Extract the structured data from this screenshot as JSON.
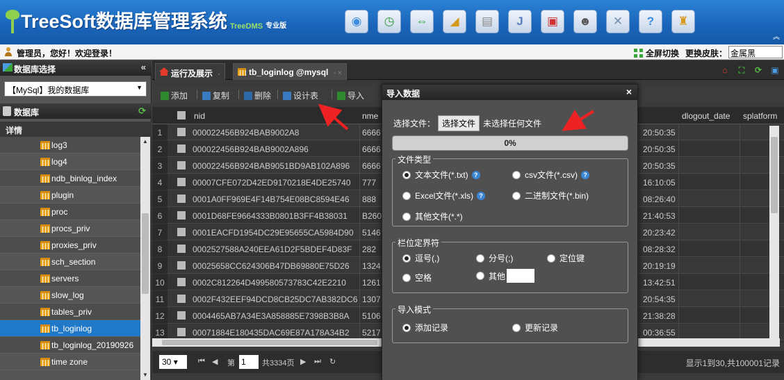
{
  "banner": {
    "title": "TreeSoft数据库管理系统",
    "subtitle": "TreeDMS",
    "edition": "专业版",
    "tools": [
      {
        "icon": "refresh-globe-icon",
        "color": "#3a8be0"
      },
      {
        "icon": "clock-icon",
        "color": "#2a9d3a"
      },
      {
        "icon": "sync-arrows-icon",
        "color": "#2a9d3a"
      },
      {
        "icon": "chart-icon",
        "color": "#d69a1a"
      },
      {
        "icon": "document-icon",
        "color": "#888888"
      },
      {
        "icon": "j-icon",
        "color": "#5b7fc0"
      },
      {
        "icon": "log-icon",
        "color": "#d03030"
      },
      {
        "icon": "user-icon",
        "color": "#555555"
      },
      {
        "icon": "tools-icon",
        "color": "#7090b0"
      },
      {
        "icon": "help-icon",
        "color": "#3a8be0"
      },
      {
        "icon": "lock-icon",
        "color": "#d69a1a"
      }
    ]
  },
  "welcome": {
    "text": "管理员，您好！欢迎登录！",
    "fullscreen": "全屏切换",
    "skin_label": "更换皮肤：",
    "skin_value": "金属黑"
  },
  "sidebar": {
    "header": "数据库选择",
    "db_select": "【MySql】我的数据库",
    "db_header": "数据库",
    "detail": "详情",
    "items": [
      {
        "label": "log3"
      },
      {
        "label": "log4"
      },
      {
        "label": "ndb_binlog_index"
      },
      {
        "label": "plugin"
      },
      {
        "label": "proc"
      },
      {
        "label": "procs_priv"
      },
      {
        "label": "proxies_priv"
      },
      {
        "label": "sch_section"
      },
      {
        "label": "servers"
      },
      {
        "label": "slow_log"
      },
      {
        "label": "tables_priv"
      },
      {
        "label": "tb_loginlog"
      },
      {
        "label": "tb_loginlog_20190926"
      },
      {
        "label": "time zone"
      }
    ],
    "active_index": 11
  },
  "tabs": [
    {
      "label": "运行及展示"
    },
    {
      "label": "tb_loginlog @mysql"
    }
  ],
  "toolbar": {
    "add": "添加",
    "copy": "复制",
    "delete": "删除",
    "design": "设计表",
    "import": "导入"
  },
  "grid": {
    "columns": {
      "nid": "nid",
      "nme": "nme",
      "dlogout": "dlogout_date",
      "splatform": "splatform"
    },
    "rows": [
      {
        "n": "1",
        "nid": "000022456B924BAB9002A8",
        "nme": "6666",
        "dt": "20:50:35"
      },
      {
        "n": "2",
        "nid": "000022456B924BAB9002A896",
        "nme": "6666",
        "dt": "20:50:35"
      },
      {
        "n": "3",
        "nid": "000022456B924BAB9051BD9AB102A896",
        "nme": "6666",
        "dt": "20:50:35"
      },
      {
        "n": "4",
        "nid": "00007CFE072D42ED9170218E4DE25740",
        "nme": "777",
        "dt": "16:10:05"
      },
      {
        "n": "5",
        "nid": "0001A0FF969E4F14B754E08BC8594E46",
        "nme": "888",
        "dt": "08:26:40"
      },
      {
        "n": "6",
        "nid": "0001D68FE9664333B0801B3FF4B38031",
        "nme": "B260",
        "dt": "21:40:53"
      },
      {
        "n": "7",
        "nid": "0001EACFD1954DC29E95655CA5984D90",
        "nme": "5146",
        "dt": "20:23:42"
      },
      {
        "n": "8",
        "nid": "0002527588A240EEA61D2F5BDEF4D83F",
        "nme": "282",
        "dt": "08:28:32"
      },
      {
        "n": "9",
        "nid": "00025658CC624306B47DB69880E75D26",
        "nme": "1324",
        "dt": "20:19:19"
      },
      {
        "n": "10",
        "nid": "0002C812264D499580573783C42E2210",
        "nme": "1261",
        "dt": "13:42:51"
      },
      {
        "n": "11",
        "nid": "0002F432EEF94DCD8CB25DC7AB382DC6",
        "nme": "1307",
        "dt": "20:54:35"
      },
      {
        "n": "12",
        "nid": "0004465AB7A34E3A858885E7398B3B8A",
        "nme": "5106",
        "dt": "21:38:28"
      },
      {
        "n": "13",
        "nid": "00071884E180435DAC69E87A178A34B2",
        "nme": "5217",
        "dt": "00:36:55"
      }
    ]
  },
  "pager": {
    "page_size": "30",
    "page_label": "第",
    "page_value": "1",
    "total_pages": "共3334页",
    "info": "显示1到30,共100001记录"
  },
  "modal": {
    "title": "导入数据",
    "file_label": "选择文件：",
    "file_button": "选择文件",
    "file_none": "未选择任何文件",
    "progress_text": "0%",
    "progress_value": 0,
    "file_type": {
      "legend": "文件类型",
      "txt": "文本文件(*.txt)",
      "csv": "csv文件(*.csv)",
      "xls": "Excel文件(*.xls)",
      "bin": "二进制文件(*.bin)",
      "other": "其他文件(*.*)"
    },
    "delimiter": {
      "legend": "栏位定界符",
      "comma": "逗号(,)",
      "semicolon": "分号(;)",
      "tab": "定位键",
      "space": "空格",
      "other": "其他"
    },
    "mode": {
      "legend": "导入模式",
      "add": "添加记录",
      "update": "更新记录"
    }
  }
}
